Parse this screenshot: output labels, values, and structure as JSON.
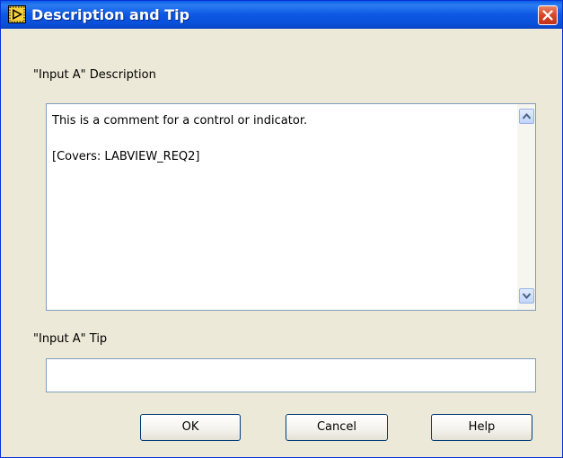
{
  "window": {
    "title": "Description and Tip",
    "title_bar_color": "#0a56e0",
    "close_button_color": "#d7462a"
  },
  "description": {
    "label": "\"Input A\" Description",
    "lines": [
      "This is a comment for a control or indicator.",
      "[Covers: LABVIEW_REQ2]"
    ]
  },
  "tip": {
    "label": "\"Input A\" Tip",
    "value": ""
  },
  "buttons": {
    "ok": "OK",
    "cancel": "Cancel",
    "help": "Help"
  },
  "icons": {
    "app": "labview-run-icon",
    "close": "close-icon",
    "scroll_up": "scroll-up-arrow-icon",
    "scroll_down": "scroll-down-arrow-icon"
  }
}
